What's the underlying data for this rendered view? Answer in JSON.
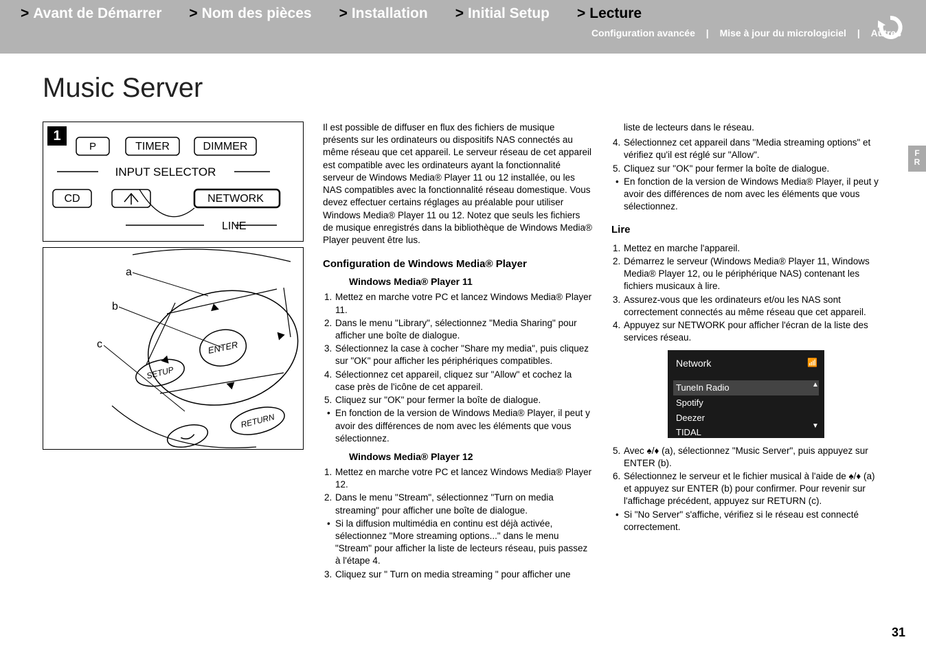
{
  "nav": {
    "items": [
      {
        "label": "Avant de Démarrer",
        "active": false
      },
      {
        "label": "Nom des pièces",
        "active": false
      },
      {
        "label": "Installation",
        "active": false
      },
      {
        "label": "Initial Setup",
        "active": false
      },
      {
        "label": "Lecture",
        "active": true
      }
    ],
    "sublinks": [
      "Configuration avancée",
      "Mise à jour du micrologiciel",
      "Autres"
    ],
    "separator": "|"
  },
  "lang_tab": "F\nR",
  "page_title": "Music Server",
  "page_number": "31",
  "diagram_top": {
    "callout": "1",
    "buttons": {
      "p": "P",
      "timer": "TIMER",
      "dimmer": "DIMMER"
    },
    "input_selector": "INPUT SELECTOR",
    "cd": "CD",
    "network": "NETWORK",
    "line": "LINE"
  },
  "diagram_bottom": {
    "labels": {
      "a": "a",
      "b": "b",
      "c": "c"
    },
    "enter": "ENTER",
    "setup": "SETUP",
    "return": "RETURN"
  },
  "col1": {
    "intro": "Il est possible de diffuser en flux des fichiers de musique présents sur les ordinateurs ou dispositifs NAS connectés au même réseau que cet appareil. Le serveur réseau de cet appareil est compatible avec les ordinateurs ayant la fonctionnalité serveur de Windows Media® Player 11 ou 12 installée, ou les NAS compatibles avec la fonctionnalité réseau domestique. Vous devez effectuer certains réglages au préalable pour utiliser Windows Media® Player 11 ou 12. Notez que seuls les fichiers de musique enregistrés dans la bibliothèque de Windows Media® Player peuvent être lus.",
    "h_config": "Configuration de Windows Media® Player",
    "h_wmp11": "Windows Media® Player 11",
    "wmp11": [
      "Mettez en marche votre PC et lancez Windows Media® Player 11.",
      "Dans le menu \"Library\", sélectionnez \"Media Sharing\" pour afficher une boîte de dialogue.",
      "Sélectionnez la case à cocher \"Share my media\", puis cliquez sur \"OK\" pour afficher les périphériques compatibles.",
      "Sélectionnez cet appareil, cliquez sur \"Allow\" et cochez la case près de l'icône de cet appareil.",
      "Cliquez sur \"OK\" pour fermer la boîte de dialogue."
    ],
    "wmp11_bullet": "En fonction de la version de Windows Media® Player, il peut y avoir des différences de nom avec les éléments que vous sélectionnez.",
    "h_wmp12": "Windows Media® Player 12",
    "wmp12": [
      "Mettez en marche votre PC et lancez Windows Media® Player 12.",
      "Dans le menu \"Stream\", sélectionnez \"Turn on media streaming\" pour afficher une boîte de dialogue."
    ],
    "wmp12_bullet": "Si la diffusion multimédia en continu est déjà activée, sélectionnez \"More streaming options...\" dans le menu \"Stream\" pour afficher la liste de lecteurs réseau, puis passez à l'étape 4.",
    "wmp12_3": "Cliquez sur \" Turn on media streaming \" pour afficher une"
  },
  "col2": {
    "top_cont": "liste de lecteurs dans le réseau.",
    "steps_top": [
      {
        "n": "4.",
        "t": "Sélectionnez cet appareil dans \"Media streaming options\" et vérifiez qu'il est réglé sur \"Allow\"."
      },
      {
        "n": "5.",
        "t": "Cliquez sur \"OK\" pour fermer la boîte de dialogue."
      }
    ],
    "top_bullet": "En fonction de la version de Windows Media® Player, il peut y avoir des différences de nom avec les éléments que vous sélectionnez.",
    "h_lire": "Lire",
    "lire": [
      "Mettez en marche l'appareil.",
      "Démarrez le serveur (Windows Media® Player 11, Windows Media® Player 12, ou le périphérique NAS) contenant les fichiers musicaux à lire.",
      "Assurez-vous que les ordinateurs et/ou les NAS sont correctement connectés au même réseau que cet appareil.",
      "Appuyez sur NETWORK pour afficher l'écran de la liste des services réseau."
    ],
    "screen": {
      "title": "Network",
      "items": [
        "TuneIn Radio",
        "Spotify",
        "Deezer",
        "TIDAL"
      ],
      "selected_index": 0
    },
    "after": [
      {
        "n": "5.",
        "t": "Avec ♠/♦ (a), sélectionnez \"Music Server\", puis appuyez sur ENTER (b)."
      },
      {
        "n": "6.",
        "t": "Sélectionnez le serveur et le fichier musical à l'aide de ♠/♦ (a) et appuyez sur ENTER (b) pour confirmer. Pour revenir sur l'affichage précédent, appuyez sur RETURN (c)."
      }
    ],
    "after_bullet": "Si \"No Server\" s'affiche, vérifiez si le réseau est connecté correctement."
  }
}
